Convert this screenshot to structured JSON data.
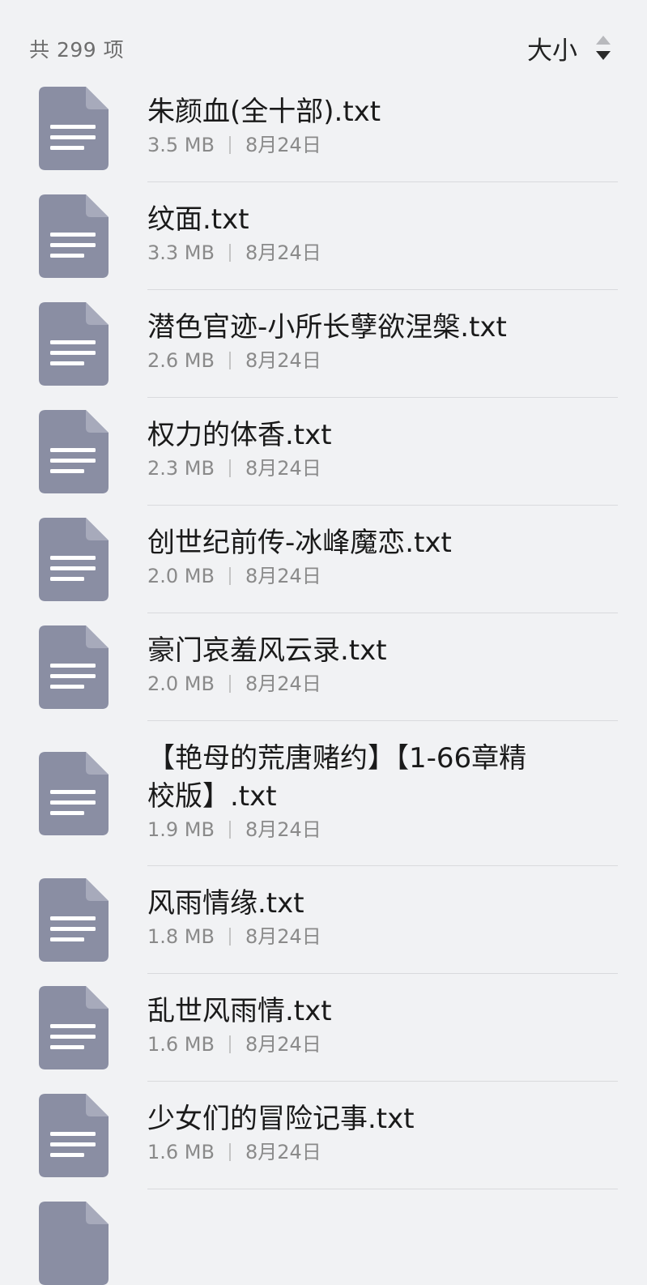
{
  "header": {
    "count_label": "共 299 项",
    "sort_label": "大小"
  },
  "icons": {
    "file_icon_color": "#8a8ea3",
    "file_icon_lines": "#ffffff"
  },
  "files": [
    {
      "name": "朱颜血(全十部).txt",
      "size": "3.5 MB",
      "date": "8月24日"
    },
    {
      "name": "纹面.txt",
      "size": "3.3 MB",
      "date": "8月24日"
    },
    {
      "name": "潜色官迹-小所长孽欲涅槃.txt",
      "size": "2.6 MB",
      "date": "8月24日"
    },
    {
      "name": "权力的体香.txt",
      "size": "2.3 MB",
      "date": "8月24日"
    },
    {
      "name": "创世纪前传-冰峰魔恋.txt",
      "size": "2.0 MB",
      "date": "8月24日"
    },
    {
      "name": "豪门哀羞风云录.txt",
      "size": "2.0 MB",
      "date": "8月24日"
    },
    {
      "name": "【艳母的荒唐赌约】【1-66章精校版】.txt",
      "size": "1.9 MB",
      "date": "8月24日"
    },
    {
      "name": "风雨情缘.txt",
      "size": "1.8 MB",
      "date": "8月24日"
    },
    {
      "name": "乱世风雨情.txt",
      "size": "1.6 MB",
      "date": "8月24日"
    },
    {
      "name": "少女们的冒险记事.txt",
      "size": "1.6 MB",
      "date": "8月24日"
    }
  ]
}
